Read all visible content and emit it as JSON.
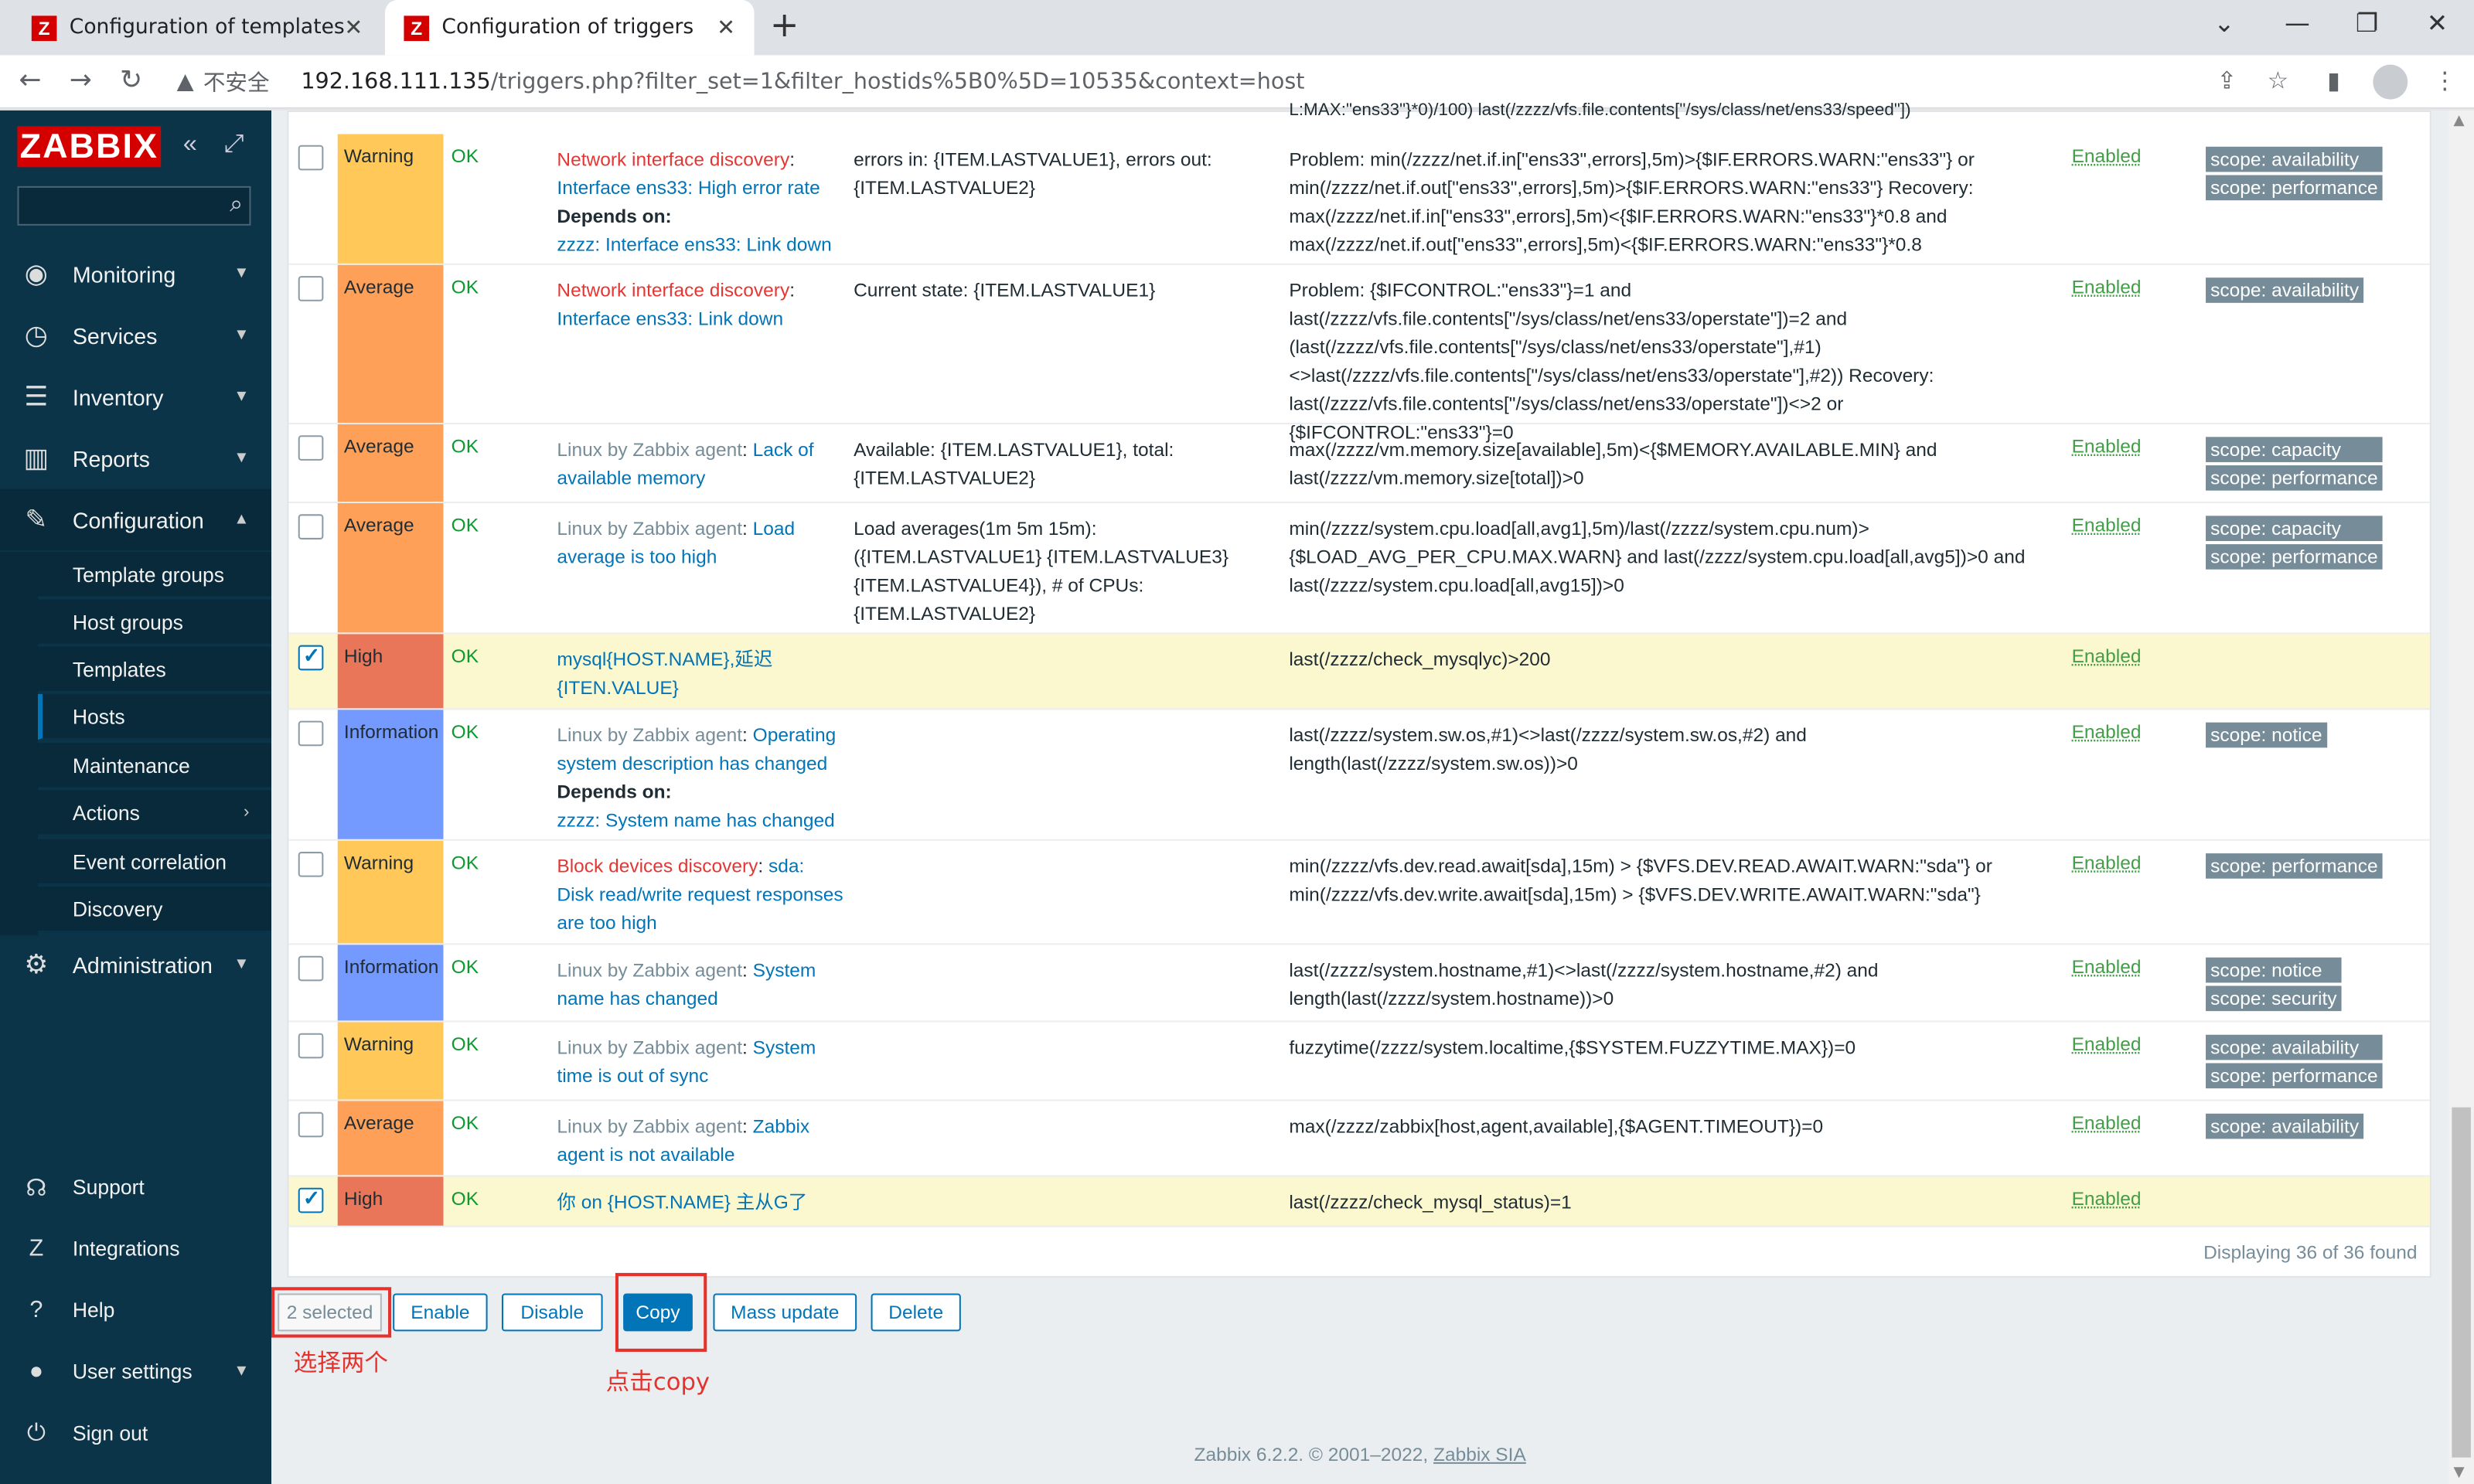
{
  "browser": {
    "tabs": [
      {
        "title": "Configuration of templates"
      },
      {
        "title": "Configuration of triggers"
      }
    ],
    "security_label": "不安全",
    "url_host": "192.168.111.135",
    "url_path": "/triggers.php?filter_set=1&filter_hostids%5B0%5D=10535&context=host"
  },
  "sidebar": {
    "logo": "ZABBIX",
    "menu": [
      {
        "label": "Monitoring",
        "icon": "eye-icon"
      },
      {
        "label": "Services",
        "icon": "clock-icon"
      },
      {
        "label": "Inventory",
        "icon": "list-icon"
      },
      {
        "label": "Reports",
        "icon": "bar-chart-icon"
      },
      {
        "label": "Configuration",
        "icon": "wrench-icon"
      }
    ],
    "submenu": [
      "Template groups",
      "Host groups",
      "Templates",
      "Hosts",
      "Maintenance",
      "Actions",
      "Event correlation",
      "Discovery"
    ],
    "admin": "Administration",
    "bottom": [
      "Support",
      "Integrations",
      "Help",
      "User settings",
      "Sign out"
    ]
  },
  "top_fragment": "L:MAX:\"ens33\"}*0)/100) last(/zzzz/vfs.file.contents[\"/sys/class/net/ens33/speed\"])",
  "rows": [
    {
      "severity": "Warning",
      "status": "OK",
      "name_prefix": "Network interface discovery",
      "name": "Interface ens33: High error rate",
      "depends_label": "Depends on:",
      "depends": "zzzz: Interface ens33: Link down",
      "opdata": "errors in: {ITEM.LASTVALUE1}, errors out: {ITEM.LASTVALUE2}",
      "expression": "Problem: min(/zzzz/net.if.in[\"ens33\",errors],5m)>{$IF.ERRORS.WARN:\"ens33\"} or min(/zzzz/net.if.out[\"ens33\",errors],5m)>{$IF.ERRORS.WARN:\"ens33\"} Recovery: max(/zzzz/net.if.in[\"ens33\",errors],5m)<{$IF.ERRORS.WARN:\"ens33\"}*0.8 and max(/zzzz/net.if.out[\"ens33\",errors],5m)<{$IF.ERRORS.WARN:\"ens33\"}*0.8",
      "state": "Enabled",
      "tags": [
        "scope: availability",
        "scope: performance"
      ]
    },
    {
      "severity": "Average",
      "status": "OK",
      "name_prefix": "Network interface discovery",
      "name": "Interface ens33: Link down",
      "opdata": "Current state: {ITEM.LASTVALUE1}",
      "expression": "Problem: {$IFCONTROL:\"ens33\"}=1 and last(/zzzz/vfs.file.contents[\"/sys/class/net/ens33/operstate\"])=2 and (last(/zzzz/vfs.file.contents[\"/sys/class/net/ens33/operstate\"],#1)<>last(/zzzz/vfs.file.contents[\"/sys/class/net/ens33/operstate\"],#2)) Recovery: last(/zzzz/vfs.file.contents[\"/sys/class/net/ens33/operstate\"])<>2 or {$IFCONTROL:\"ens33\"}=0",
      "state": "Enabled",
      "tags": [
        "scope: availability"
      ]
    },
    {
      "severity": "Average",
      "status": "OK",
      "name_prefix": "Linux by Zabbix agent",
      "name": "Lack of available memory",
      "opdata": "Available: {ITEM.LASTVALUE1}, total: {ITEM.LASTVALUE2}",
      "expression": "max(/zzzz/vm.memory.size[available],5m)<{$MEMORY.AVAILABLE.MIN} and last(/zzzz/vm.memory.size[total])>0",
      "state": "Enabled",
      "tags": [
        "scope: capacity",
        "scope: performance"
      ]
    },
    {
      "severity": "Average",
      "status": "OK",
      "name_prefix": "Linux by Zabbix agent",
      "name": "Load average is too high",
      "opdata": "Load averages(1m 5m 15m): ({ITEM.LASTVALUE1} {ITEM.LASTVALUE3} {ITEM.LASTVALUE4}), # of CPUs: {ITEM.LASTVALUE2}",
      "expression": "min(/zzzz/system.cpu.load[all,avg1],5m)/last(/zzzz/system.cpu.num)>{$LOAD_AVG_PER_CPU.MAX.WARN} and last(/zzzz/system.cpu.load[all,avg5])>0 and last(/zzzz/system.cpu.load[all,avg15])>0",
      "state": "Enabled",
      "tags": [
        "scope: capacity",
        "scope: performance"
      ]
    },
    {
      "severity": "High",
      "status": "OK",
      "name_prefix": "",
      "name": "mysql{HOST.NAME},延迟{ITEN.VALUE}",
      "opdata": "",
      "expression": "last(/zzzz/check_mysqlyc)>200",
      "state": "Enabled",
      "tags": [],
      "checked": true
    },
    {
      "severity": "Information",
      "status": "OK",
      "name_prefix": "Linux by Zabbix agent",
      "name": "Operating system description has changed",
      "depends_label": "Depends on:",
      "depends": "zzzz: System name has changed",
      "opdata": "",
      "expression": "last(/zzzz/system.sw.os,#1)<>last(/zzzz/system.sw.os,#2) and length(last(/zzzz/system.sw.os))>0",
      "state": "Enabled",
      "tags": [
        "scope: notice"
      ]
    },
    {
      "severity": "Warning",
      "status": "OK",
      "name_prefix": "Block devices discovery",
      "name": "sda: Disk read/write request responses are too high",
      "opdata": "",
      "expression": "min(/zzzz/vfs.dev.read.await[sda],15m) > {$VFS.DEV.READ.AWAIT.WARN:\"sda\"} or min(/zzzz/vfs.dev.write.await[sda],15m) > {$VFS.DEV.WRITE.AWAIT.WARN:\"sda\"}",
      "state": "Enabled",
      "tags": [
        "scope: performance"
      ]
    },
    {
      "severity": "Information",
      "status": "OK",
      "name_prefix": "Linux by Zabbix agent",
      "name": "System name has changed",
      "opdata": "",
      "expression": "last(/zzzz/system.hostname,#1)<>last(/zzzz/system.hostname,#2) and length(last(/zzzz/system.hostname))>0",
      "state": "Enabled",
      "tags": [
        "scope: notice",
        "scope: security"
      ]
    },
    {
      "severity": "Warning",
      "status": "OK",
      "name_prefix": "Linux by Zabbix agent",
      "name": "System time is out of sync",
      "opdata": "",
      "expression": "fuzzytime(/zzzz/system.localtime,{$SYSTEM.FUZZYTIME.MAX})=0",
      "state": "Enabled",
      "tags": [
        "scope: availability",
        "scope: performance"
      ]
    },
    {
      "severity": "Average",
      "status": "OK",
      "name_prefix": "Linux by Zabbix agent",
      "name": "Zabbix agent is not available",
      "opdata": "",
      "expression": "max(/zzzz/zabbix[host,agent,available],{$AGENT.TIMEOUT})=0",
      "state": "Enabled",
      "tags": [
        "scope: availability"
      ]
    },
    {
      "severity": "High",
      "status": "OK",
      "name_prefix": "",
      "name": "你 on {HOST.NAME} 主从G了",
      "opdata": "",
      "expression": "last(/zzzz/check_mysql_status)=1",
      "state": "Enabled",
      "tags": [],
      "checked": true
    }
  ],
  "displaying": "Displaying 36 of 36 found",
  "actions": {
    "selected": "2 selected",
    "enable": "Enable",
    "disable": "Disable",
    "copy": "Copy",
    "mass_update": "Mass update",
    "delete": "Delete"
  },
  "annotations": {
    "select_two": "选择两个",
    "click_copy": "点击copy"
  },
  "footer": {
    "text": "Zabbix 6.2.2. © 2001–2022,",
    "link": "Zabbix SIA"
  },
  "colors": {
    "warning": "#ffc859",
    "average": "#ffa059",
    "high": "#e97659",
    "information": "#7499ff",
    "brand": "#d40000",
    "sidebar": "#0b3449",
    "link": "#0275b8",
    "annotation": "#e5322d"
  }
}
